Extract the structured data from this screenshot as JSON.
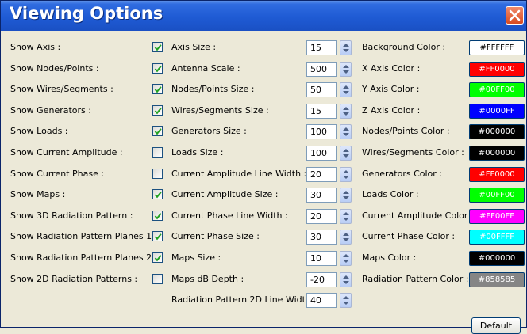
{
  "window": {
    "title": "Viewing Options",
    "close_icon": "close-icon"
  },
  "show_options": [
    {
      "label": "Show Axis :",
      "checked": true
    },
    {
      "label": "Show Nodes/Points :",
      "checked": true
    },
    {
      "label": "Show Wires/Segments :",
      "checked": true
    },
    {
      "label": "Show Generators :",
      "checked": true
    },
    {
      "label": "Show Loads :",
      "checked": true
    },
    {
      "label": "Show Current Amplitude :",
      "checked": false
    },
    {
      "label": "Show Current Phase :",
      "checked": false
    },
    {
      "label": "Show Maps :",
      "checked": true
    },
    {
      "label": "Show 3D Radiation Pattern :",
      "checked": true
    },
    {
      "label": "Show Radiation Pattern Planes 1 :",
      "checked": true
    },
    {
      "label": "Show Radiation Pattern Planes 2 :",
      "checked": true
    },
    {
      "label": "Show 2D Radiation Patterns :",
      "checked": false
    }
  ],
  "size_options": [
    {
      "label": "Axis Size :",
      "value": "15"
    },
    {
      "label": "Antenna Scale :",
      "value": "500"
    },
    {
      "label": "Nodes/Points Size :",
      "value": "50"
    },
    {
      "label": "Wires/Segments Size :",
      "value": "15"
    },
    {
      "label": "Generators Size :",
      "value": "100"
    },
    {
      "label": "Loads Size :",
      "value": "100"
    },
    {
      "label": "Current Amplitude Line Width :",
      "value": "20"
    },
    {
      "label": "Current Amplitude Size :",
      "value": "30"
    },
    {
      "label": "Current Phase Line Width :",
      "value": "20"
    },
    {
      "label": "Current Phase Size :",
      "value": "30"
    },
    {
      "label": "Maps Size :",
      "value": "10"
    },
    {
      "label": "Maps dB Depth :",
      "value": "-20"
    },
    {
      "label": "Radiation Pattern 2D Line Width :",
      "value": "40"
    }
  ],
  "color_options": [
    {
      "label": "Background Color :",
      "value": "#FFFFFF",
      "bg": "#FFFFFF",
      "fg": "#000000"
    },
    {
      "label": "X Axis Color :",
      "value": "#FF0000",
      "bg": "#FF0000",
      "fg": "#FFFFFF"
    },
    {
      "label": "Y Axis Color :",
      "value": "#00FF00",
      "bg": "#00FF00",
      "fg": "#FFFFFF"
    },
    {
      "label": "Z Axis Color :",
      "value": "#0000FF",
      "bg": "#0000FF",
      "fg": "#FFFFFF"
    },
    {
      "label": "Nodes/Points Color :",
      "value": "#000000",
      "bg": "#000000",
      "fg": "#FFFFFF"
    },
    {
      "label": "Wires/Segments Color :",
      "value": "#000000",
      "bg": "#000000",
      "fg": "#FFFFFF"
    },
    {
      "label": "Generators Color :",
      "value": "#FF0000",
      "bg": "#FF0000",
      "fg": "#FFFFFF"
    },
    {
      "label": "Loads Color :",
      "value": "#00FF00",
      "bg": "#00FF00",
      "fg": "#FFFFFF"
    },
    {
      "label": "Current Amplitude Color :",
      "value": "#FF00FF",
      "bg": "#FF00FF",
      "fg": "#FFFFFF"
    },
    {
      "label": "Current Phase Color :",
      "value": "#00FFFF",
      "bg": "#00FFFF",
      "fg": "#FFFFFF"
    },
    {
      "label": "Maps Color :",
      "value": "#000000",
      "bg": "#000000",
      "fg": "#FFFFFF"
    },
    {
      "label": "Radiation Pattern Color :",
      "value": "#858585",
      "bg": "#858585",
      "fg": "#FFFFFF"
    }
  ],
  "footer": {
    "default_label": "Default"
  },
  "colors": {
    "title_bar": "#2f6be0",
    "dialog_bg": "#ece9d8",
    "close_button": "#d84a20"
  }
}
